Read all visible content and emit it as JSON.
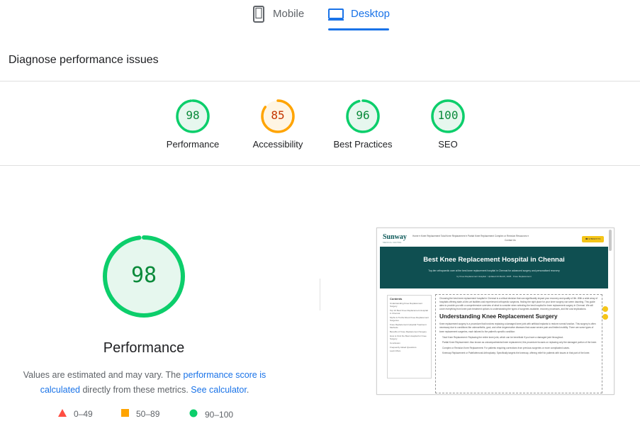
{
  "tabs": [
    {
      "label": "Mobile",
      "icon": "smartphone-icon",
      "active": false
    },
    {
      "label": "Desktop",
      "icon": "desktop-icon",
      "active": true
    }
  ],
  "section_title": "Diagnose performance issues",
  "categories": [
    {
      "label": "Performance",
      "score": "98",
      "value": 98,
      "color": "#0cce6b",
      "text_color": "#0a8a3a",
      "fill": "#e6f7ee"
    },
    {
      "label": "Accessibility",
      "score": "85",
      "value": 85,
      "color": "#ffa400",
      "text_color": "#c33300",
      "fill": "#fff5e3"
    },
    {
      "label": "Best Practices",
      "score": "96",
      "value": 96,
      "color": "#0cce6b",
      "text_color": "#0a8a3a",
      "fill": "#e6f7ee"
    },
    {
      "label": "SEO",
      "score": "100",
      "value": 100,
      "color": "#0cce6b",
      "text_color": "#0a8a3a",
      "fill": "#e6f7ee"
    }
  ],
  "main_gauge": {
    "score": "98",
    "value": 98,
    "label": "Performance",
    "color": "#0cce6b"
  },
  "note": {
    "text_1": "Values are estimated and may vary. The ",
    "link_1": "performance score is calculated",
    "text_2": " directly from these metrics. ",
    "link_2": "See calculator",
    "text_3": "."
  },
  "legend": [
    {
      "label": "0–49",
      "shape": "triangle",
      "color": "#ff4e42"
    },
    {
      "label": "50–89",
      "shape": "square",
      "color": "#ffa400"
    },
    {
      "label": "90–100",
      "shape": "circle",
      "color": "#0cce6b"
    }
  ],
  "screenshot": {
    "logo": "Sunway",
    "logo_sub": "MEDICAL CENTRE",
    "nav": "Home ▾   Knee Replacement   Total Knee Replacement ▾   Partial Knee Replacement   Complex or Revision   Resources ▾",
    "nav_2": "Contact Us",
    "cta": "☎ 9786937773",
    "hero_title": "Best Knee Replacement Hospital in Chennai",
    "hero_sub": "Top-tier orthopaedic care at the best knee replacement hospital in Chennai for advanced surgery and personalised recovery",
    "hero_meta": "by Knee Replacement Hospital  ·  Updated 24 March, 2025  ·  Knee Replacement",
    "toc_title": "Contents",
    "toc_items": [
      "Understanding Knee Replacement Surgery",
      "Top 10 Best Knee Replacement Hospital in Chennai",
      "Myths & Truths About Knee Replacement Surgeries",
      "Knee Replacement Hospital Treatment Methods",
      "Benefits of Knee Replacement Surgery",
      "How to Find the Best Hospital for Knee Surgery",
      "Conclusion",
      "Frequently Asked Questions",
      "Learn More"
    ],
    "intro": "Choosing the best knee replacement hospital in Chennai is a critical decision that can significantly impact your recovery and quality of life. With a wide array of hospitals offering state-of-the-art facilities and experienced orthopedic surgeons, finding the right place for your knee surgery can seem daunting. This guide aims to provide you with a comprehensive overview of what to consider when selecting the best hospital for knee replacement surgery in Chennai. We will cover everything from knee pain treatment options to understanding the types of surgeries available, recovery processes, and the cost implications.",
    "h2": "Understanding Knee Replacement Surgery",
    "para2": "Knee replacement surgery is a procedure that involves replacing a damaged knee joint with artificial implants to restore normal function. This surgery is often necessary due to conditions like osteoarthritis, gout, and other degenerative diseases that cause severe pain and limited mobility. There are some types of knee replacement surgeries, each tailored to the patient's specific condition:",
    "bullets": [
      "Total Knee Replacement: Replacing the entire knee joint, which can be beneficial if you have a damaged joint throughout.",
      "Partial Knee Replacement: Also known as unicompartmental knee replacement, this procedure focuses on replacing only the damaged portion of the knee.",
      "Complex or Revision Knee Replacement: For patients requiring corrections from previous surgeries or more complicated cases.",
      "Kneecap Replacement or Patellofemoral Arthroplasty: Specifically targets the kneecap, offering relief for patients with issues in that part of the knee."
    ]
  }
}
